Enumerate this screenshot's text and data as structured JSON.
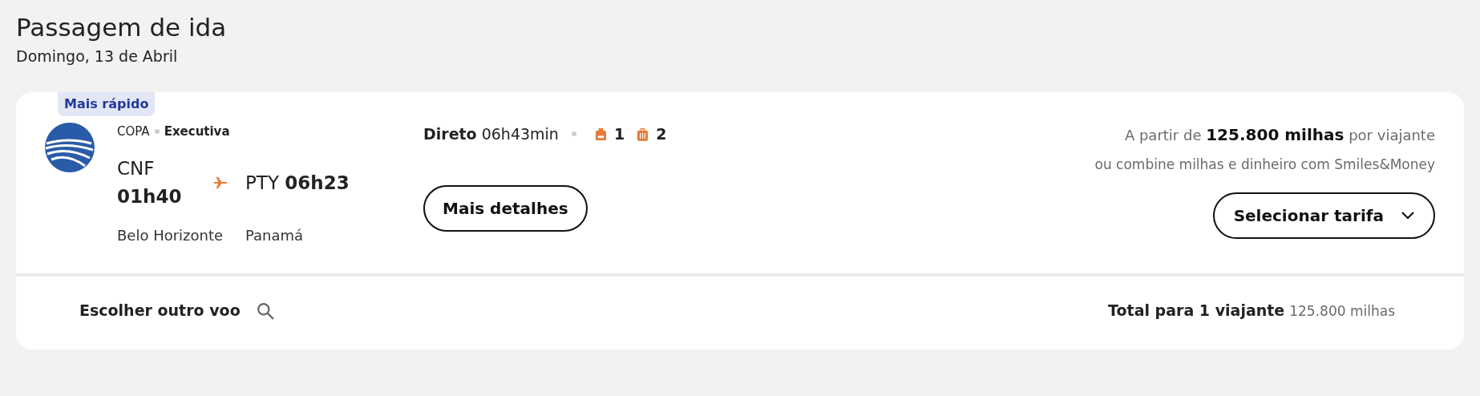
{
  "heading": {
    "title": "Passagem de ida",
    "date": "Domingo, 13 de Abril"
  },
  "flight": {
    "badge": "Mais rápido",
    "airline": "COPA",
    "cabin": "Executiva",
    "origin": {
      "code": "CNF",
      "time": "01h40",
      "city": "Belo Horizonte"
    },
    "destination": {
      "code": "PTY",
      "time": "06h23",
      "city": "Panamá"
    },
    "stops": "Direto",
    "duration": "06h43min",
    "baggage": [
      {
        "kind": "backpack",
        "count": "1"
      },
      {
        "kind": "suitcase",
        "count": "2"
      }
    ],
    "details_button": "Mais detalhes",
    "price_text": "A partir de **125.800 milhas**  por viajante",
    "combine_text": "ou combine milhas e dinheiro com Smiles&Money",
    "select_button": "Selecionar tarifa"
  },
  "footer": {
    "change_flight": "Escolher outro voo",
    "total_label": "Total para 1 viajante",
    "total_value": "125.800 milhas"
  }
}
